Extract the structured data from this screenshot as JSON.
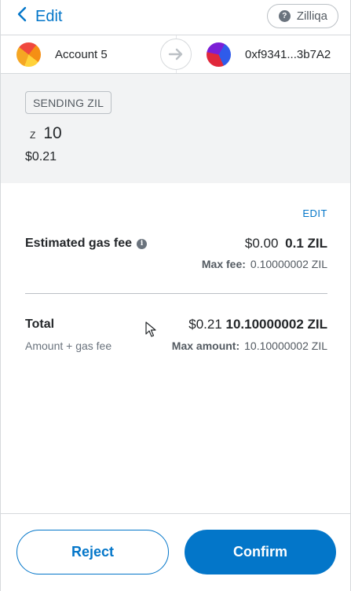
{
  "header": {
    "back_label": "Edit",
    "network_label": "Zilliqa",
    "network_icon": "question-icon"
  },
  "parties": {
    "from_name": "Account 5",
    "to_address": "0xf9341...3b7A2"
  },
  "sending": {
    "tag": "SENDING ZIL",
    "currency_symbol": "Z",
    "amount": "10",
    "fiat": "$0.21"
  },
  "details": {
    "edit_label": "EDIT",
    "gas": {
      "title": "Estimated gas fee",
      "fiat": "$0.00",
      "native": "0.1 ZIL",
      "max_label": "Max fee:",
      "max_value": "0.10000002 ZIL"
    },
    "total": {
      "title": "Total",
      "subtitle": "Amount + gas fee",
      "fiat": "$0.21",
      "native": "10.10000002 ZIL",
      "max_label": "Max amount:",
      "max_value": "10.10000002 ZIL"
    }
  },
  "footer": {
    "reject_label": "Reject",
    "confirm_label": "Confirm"
  },
  "colors": {
    "accent": "#0376c9",
    "panel_bg": "#f2f3f4",
    "border": "#d6d9dc"
  }
}
